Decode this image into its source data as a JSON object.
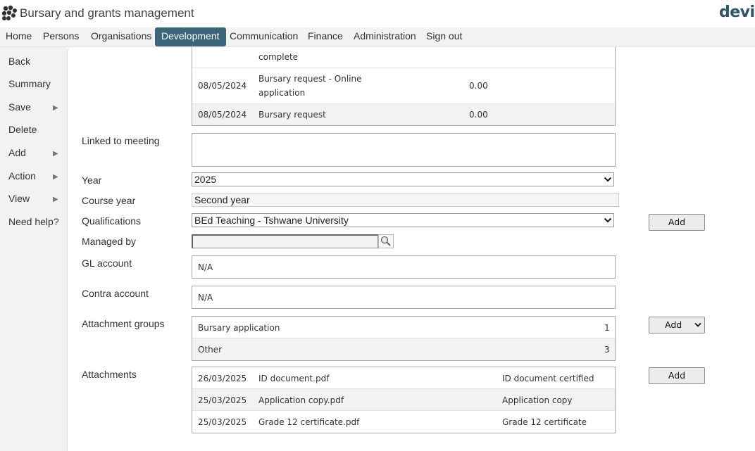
{
  "app": {
    "title": "Bursary and grants management",
    "brand": "devi"
  },
  "nav": {
    "items": [
      "Home",
      "Persons",
      "Organisations",
      "Development",
      "Communication",
      "Finance",
      "Administration",
      "Sign out"
    ],
    "active": "Development"
  },
  "sidebar": {
    "items": [
      {
        "label": "Back",
        "has_submenu": false
      },
      {
        "label": "Summary",
        "has_submenu": false
      },
      {
        "label": "Save",
        "has_submenu": true
      },
      {
        "label": "Delete",
        "has_submenu": false
      },
      {
        "label": "Add",
        "has_submenu": true
      },
      {
        "label": "Action",
        "has_submenu": true
      },
      {
        "label": "View",
        "has_submenu": true
      },
      {
        "label": "Need help?",
        "has_submenu": false
      }
    ]
  },
  "history": {
    "rows": [
      {
        "date": "",
        "description": "complete",
        "amount": ""
      },
      {
        "date": "08/05/2024",
        "description": "Bursary request - Online",
        "description2": "application",
        "amount": "0.00"
      },
      {
        "date": "08/05/2024",
        "description": "Bursary request",
        "amount": "0.00"
      }
    ]
  },
  "form": {
    "linked_meeting_label": "Linked to meeting",
    "year_label": "Year",
    "year_value": "2025",
    "course_year_label": "Course year",
    "course_year_value": "Second year",
    "qualifications_label": "Qualifications",
    "qualifications_value": "BEd Teaching - Tshwane University",
    "qualifications_add": "Add",
    "managed_by_label": "Managed by",
    "managed_by_value": "",
    "gl_account_label": "GL account",
    "gl_account_value": "N/A",
    "contra_account_label": "Contra account",
    "contra_account_value": "N/A",
    "attachment_groups_label": "Attachment groups",
    "attachment_groups_add": "Add",
    "attachment_groups": [
      {
        "name": "Bursary application",
        "count": "1"
      },
      {
        "name": "Other",
        "count": "3"
      }
    ],
    "attachments_label": "Attachments",
    "attachments_add": "Add",
    "attachments": [
      {
        "date": "26/03/2025",
        "file": "ID document.pdf",
        "type": "ID document certified"
      },
      {
        "date": "25/03/2025",
        "file": "Application copy.pdf",
        "type": "Application copy"
      },
      {
        "date": "25/03/2025",
        "file": "Grade 12 certificate.pdf",
        "type": "Grade 12 certificate"
      }
    ]
  },
  "colors": {
    "nav_active": "#3b6579",
    "brand": "#2e5468"
  },
  "icons": [
    "app-logo-icon",
    "chevron-right-icon",
    "chevron-down-icon",
    "search-icon"
  ]
}
